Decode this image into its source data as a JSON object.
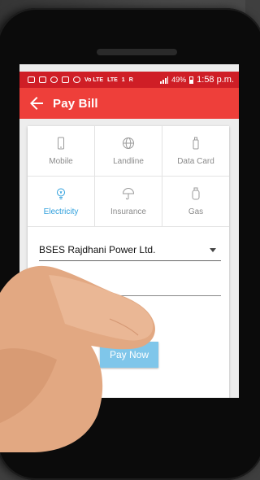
{
  "status_bar": {
    "network_labels": [
      "Vo LTE",
      "LTE"
    ],
    "sim_label": "1",
    "signal_label": "R",
    "battery": "49%",
    "time": "1:58 p.m."
  },
  "app_bar": {
    "title": "Pay Bill",
    "back_icon": "arrow-left-icon",
    "color": "#ee3f3a"
  },
  "categories": [
    {
      "label": "Mobile",
      "icon": "mobile-icon",
      "selected": false
    },
    {
      "label": "Landline",
      "icon": "globe-icon",
      "selected": false
    },
    {
      "label": "Data Card",
      "icon": "data-card-icon",
      "selected": false
    },
    {
      "label": "Electricity",
      "icon": "bulb-icon",
      "selected": true
    },
    {
      "label": "Insurance",
      "icon": "umbrella-icon",
      "selected": false
    },
    {
      "label": "Gas",
      "icon": "gas-cylinder-icon",
      "selected": false
    }
  ],
  "form": {
    "provider_selected": "BSES Rajdhani Power Ltd.",
    "account_value": ""
  },
  "pay_button": {
    "label": "Pay Now",
    "color": "#7fc6ea"
  },
  "colors": {
    "status_bar": "#cf1e26",
    "selected_category": "#2e9fdc"
  }
}
